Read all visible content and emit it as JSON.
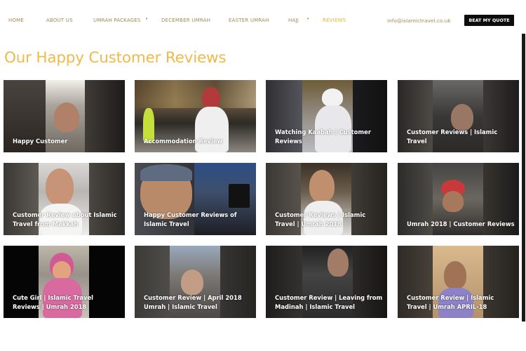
{
  "nav": {
    "items": [
      {
        "label": "HOME",
        "active": false
      },
      {
        "label": "ABOUT US",
        "active": false
      },
      {
        "label": "UMRAH PACKAGES",
        "active": false
      },
      {
        "label": "DECEMBER UMRAH",
        "active": false
      },
      {
        "label": "EASTER UMRAH",
        "active": false
      },
      {
        "label": "HAJJ",
        "active": false
      },
      {
        "label": "REVIEWS",
        "active": true
      }
    ],
    "dropdown_icon": "•",
    "email": "info@islamictravel.co.uk",
    "quote_button": "BEAT MY QUOTE"
  },
  "page": {
    "title": "Our Happy Customer Reviews"
  },
  "colors": {
    "nav_text": "#a58a52",
    "nav_active": "#e6b52b",
    "title": "#f0b94a",
    "button_bg": "#0d0d0d"
  },
  "reviews": [
    {
      "title": "Happy Customer"
    },
    {
      "title": "Accommodation Review"
    },
    {
      "title": "Watching Kaabah | Customer Reviews"
    },
    {
      "title": "Customer Reviews | Islamic Travel"
    },
    {
      "title": "Customer Review about Islamic Travel from Makkah"
    },
    {
      "title": "Happy Customer Reviews of Islamic Travel"
    },
    {
      "title": "Customer Reviews | Islamic Travel | Umrah 2018"
    },
    {
      "title": "Umrah 2018 | Customer Reviews"
    },
    {
      "title": "Cute Girl | Islamic Travel Reviews | Umrah 2018"
    },
    {
      "title": "Customer Review | April 2018 Umrah | Islamic Travel"
    },
    {
      "title": "Customer Review | Leaving from Madinah | Islamic Travel"
    },
    {
      "title": "Customer Review | Islamic Travel | Umrah APRIL-18"
    }
  ]
}
